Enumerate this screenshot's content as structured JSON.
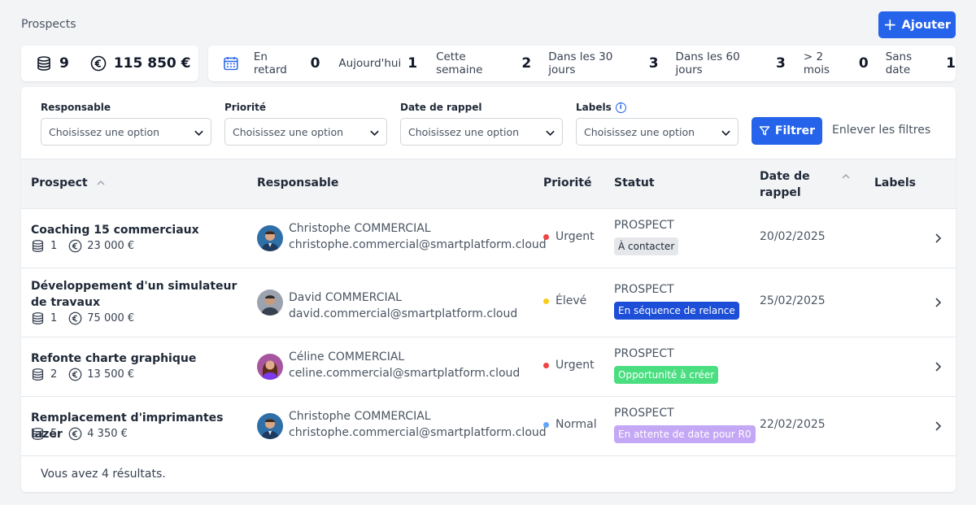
{
  "header": {
    "title": "Prospects",
    "add_label": "Ajouter",
    "add_icon": "plus-icon"
  },
  "totals": {
    "count": "9",
    "amount": "115 850 €"
  },
  "buckets": [
    {
      "label": "En retard",
      "count": "0"
    },
    {
      "label": "Aujourd'hui",
      "count": "1"
    },
    {
      "label": "Cette semaine",
      "count": "2"
    },
    {
      "label": "Dans les 30 jours",
      "count": "3"
    },
    {
      "label": "Dans les 60 jours",
      "count": "3"
    },
    {
      "label": "> 2 mois",
      "count": "0"
    },
    {
      "label": "Sans date",
      "count": "1"
    }
  ],
  "filters": {
    "fields": [
      {
        "label": "Responsable",
        "value": "Choisissez une option"
      },
      {
        "label": "Priorité",
        "value": "Choisissez une option"
      },
      {
        "label": "Date de rappel",
        "value": "Choisissez une option"
      },
      {
        "label": "Labels",
        "value": "Choisissez une option"
      }
    ],
    "filter_label": "Filtrer",
    "clear_label": "Enlever les filtres"
  },
  "table": {
    "columns": {
      "prospect": "Prospect",
      "responsable": "Responsable",
      "priorite": "Priorité",
      "statut": "Statut",
      "date_line1": "Date de",
      "date_line2": "rappel",
      "labels": "Labels"
    },
    "rows": [
      {
        "name": "Coaching 15 commerciaux",
        "count": "1",
        "amount": "23 000 €",
        "resp_name": "Christophe COMMERCIAL",
        "resp_email": "christophe.commercial@smartplatform.cloud",
        "priority": "Urgent",
        "priority_color": "#ef4444",
        "status": "PROSPECT",
        "badge": "À contacter",
        "badge_bg": "#e5e7eb",
        "badge_fg": "#1f2937",
        "date": "20/02/2025"
      },
      {
        "name": "Développement d'un simulateur de travaux",
        "count": "1",
        "amount": "75 000 €",
        "resp_name": "David COMMERCIAL",
        "resp_email": "david.commercial@smartplatform.cloud",
        "priority": "Élevé",
        "priority_color": "#facc15",
        "status": "PROSPECT",
        "badge": "En séquence de relance",
        "badge_bg": "#1d4ed8",
        "badge_fg": "#ffffff",
        "date": "25/02/2025"
      },
      {
        "name": "Refonte charte graphique",
        "count": "2",
        "amount": "13 500 €",
        "resp_name": "Céline COMMERCIAL",
        "resp_email": "celine.commercial@smartplatform.cloud",
        "priority": "Urgent",
        "priority_color": "#ef4444",
        "status": "PROSPECT",
        "badge": "Opportunité à créer",
        "badge_bg": "#4ade80",
        "badge_fg": "#ffffff",
        "date": ""
      },
      {
        "name": "Remplacement d'imprimantes lazer",
        "count": "5",
        "amount": "4 350 €",
        "resp_name": "Christophe COMMERCIAL",
        "resp_email": "christophe.commercial@smartplatform.cloud",
        "priority": "Normal",
        "priority_color": "#60a5fa",
        "status": "PROSPECT",
        "badge": "En attente de date pour R0",
        "badge_bg": "#c4a7f5",
        "badge_fg": "#ffffff",
        "date": "22/02/2025"
      }
    ]
  },
  "footer": {
    "results_text": "Vous avez 4 résultats."
  }
}
